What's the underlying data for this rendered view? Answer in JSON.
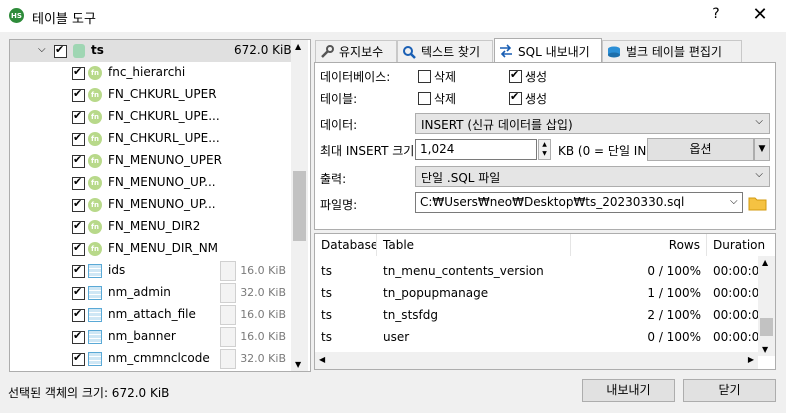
{
  "window": {
    "title": "테이블 도구",
    "help": "?",
    "close": "✕",
    "app_icon": "HS"
  },
  "tree": {
    "root": {
      "label": "ts",
      "size": "672.0 KiB",
      "checked": true
    },
    "items": [
      {
        "label": "fnc_hierarchi",
        "kind": "function",
        "checked": true
      },
      {
        "label": "FN_CHKURL_UPER",
        "kind": "function",
        "checked": true
      },
      {
        "label": "FN_CHKURL_UPE...",
        "kind": "function",
        "checked": true
      },
      {
        "label": "FN_CHKURL_UPE...",
        "kind": "function",
        "checked": true
      },
      {
        "label": "FN_MENUNO_UPER",
        "kind": "function",
        "checked": true
      },
      {
        "label": "FN_MENUNO_UP...",
        "kind": "function",
        "checked": true
      },
      {
        "label": "FN_MENUNO_UP...",
        "kind": "function",
        "checked": true
      },
      {
        "label": "FN_MENU_DIR2",
        "kind": "function",
        "checked": true
      },
      {
        "label": "FN_MENU_DIR_NM",
        "kind": "function",
        "checked": true
      },
      {
        "label": "ids",
        "kind": "table",
        "checked": true,
        "size": "16.0 KiB"
      },
      {
        "label": "nm_admin",
        "kind": "table",
        "checked": true,
        "size": "32.0 KiB"
      },
      {
        "label": "nm_attach_file",
        "kind": "table",
        "checked": true,
        "size": "16.0 KiB"
      },
      {
        "label": "nm_banner",
        "kind": "table",
        "checked": true,
        "size": "16.0 KiB"
      },
      {
        "label": "nm_cmmnclcode",
        "kind": "table",
        "checked": true,
        "size": "32.0 KiB"
      }
    ],
    "scroll_position": 0.5
  },
  "tabs": [
    {
      "label": "유지보수",
      "icon": "wrench-icon",
      "active": false
    },
    {
      "label": "텍스트 찾기",
      "icon": "search-icon",
      "active": false
    },
    {
      "label": "SQL 내보내기",
      "icon": "export-arrows-icon",
      "active": true
    },
    {
      "label": "벌크 테이블 편집기",
      "icon": "database-stack-icon",
      "active": false
    }
  ],
  "export_form": {
    "database_label": "데이터베이스:",
    "table_label": "테이블:",
    "drop_label": "삭제",
    "create_label": "생성",
    "database_drop": false,
    "database_create": true,
    "table_drop": false,
    "table_create": true,
    "data_label": "데이터:",
    "data_value": "INSERT (신규 데이터를 삽입)",
    "max_insert_label": "최대 INSERT 크기:",
    "max_insert_value": "1,024",
    "max_insert_unit": "KB (0 = 단일 IN",
    "options_button": "옵션",
    "output_label": "출력:",
    "output_value": "단일 .SQL 파일",
    "filename_label": "파일명:",
    "filename_value": "C:₩Users₩neo₩Desktop₩ts_20230330.sql"
  },
  "grid": {
    "columns": [
      "Database",
      "Table",
      "Rows",
      "Duration"
    ],
    "rows": [
      {
        "database": "ts",
        "table": "tn_menu_contents_version",
        "rows": "0 / 100%",
        "duration": "00:00:0"
      },
      {
        "database": "ts",
        "table": "tn_popupmanage",
        "rows": "1 / 100%",
        "duration": "00:00:0"
      },
      {
        "database": "ts",
        "table": "tn_stsfdg",
        "rows": "2 / 100%",
        "duration": "00:00:0"
      },
      {
        "database": "ts",
        "table": "user",
        "rows": "0 / 100%",
        "duration": "00:00:0"
      }
    ]
  },
  "status": {
    "selected_size": "선택된 객체의 크기: 672.0 KiB"
  },
  "footer": {
    "export_button": "내보내기",
    "close_button": "닫기"
  }
}
